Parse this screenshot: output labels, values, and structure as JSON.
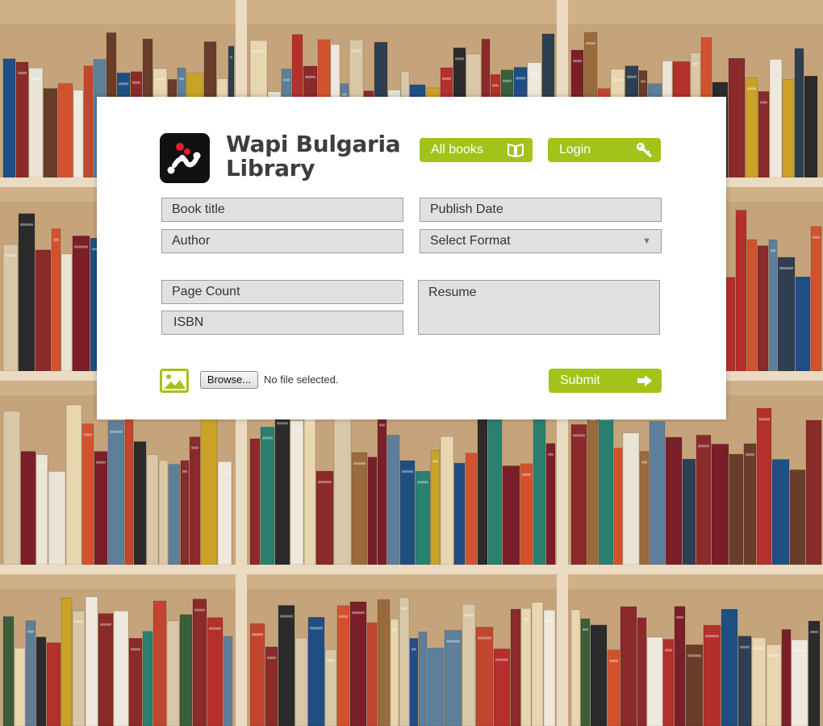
{
  "brand": {
    "line1": "Wapi Bulgaria",
    "line2": "Library"
  },
  "nav": {
    "all_books": "All books",
    "login": "Login"
  },
  "form": {
    "book_title_placeholder": "Book title",
    "publish_date_placeholder": "Publish Date",
    "author_placeholder": "Author",
    "format_selected": "Select Format",
    "page_count_placeholder": "Page Count",
    "isbn_placeholder": "ISBN",
    "resume_placeholder": "Resume",
    "browse_label": "Browse...",
    "file_status": "No file selected.",
    "submit_label": "Submit"
  },
  "colors": {
    "accent": "#a3c31a",
    "field_bg": "#e1e1e1",
    "field_border": "#9d9d9d",
    "brand_text": "#3d3d3d"
  },
  "icons": {
    "logo": "wapi-logo-icon",
    "all_books": "open-book-icon",
    "login": "key-icon",
    "submit": "arrow-right-icon",
    "image": "image-icon",
    "select": "chevron-down-icon"
  }
}
